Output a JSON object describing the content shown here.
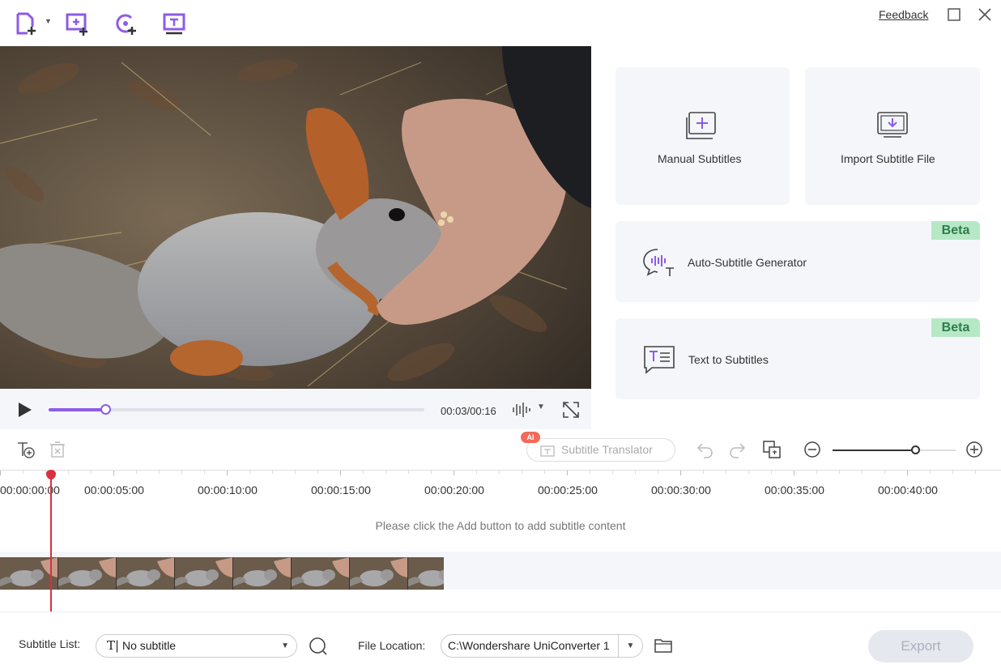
{
  "topbar": {
    "icons": [
      "add-file-icon",
      "add-media-icon",
      "refresh-add-icon",
      "text-subtitle-icon"
    ],
    "feedback_label": "Feedback"
  },
  "player": {
    "time_display": "00:03/00:16",
    "progress": 0.15
  },
  "panel": {
    "manual_subtitles": "Manual Subtitles",
    "import_subtitle": "Import Subtitle File",
    "auto_subtitle": "Auto-Subtitle Generator",
    "text_to_subtitles": "Text to Subtitles",
    "beta_label": "Beta"
  },
  "toolbar": {
    "ai_badge": "AI",
    "translator_label": "Subtitle Translator",
    "zoom_level": 0.67
  },
  "ruler": {
    "ticks": [
      "00:00:00:00",
      "00:00:05:00",
      "00:00:10:00",
      "00:00:15:00",
      "00:00:20:00",
      "00:00:25:00",
      "00:00:30:00",
      "00:00:35:00",
      "00:00:40:00"
    ]
  },
  "timeline": {
    "hint": "Please click the Add button to add subtitle content"
  },
  "bottom": {
    "subtitle_list_label": "Subtitle List:",
    "subtitle_list_value": "No subtitle",
    "file_location_label": "File Location:",
    "file_location_value": "C:\\Wondershare UniConverter 1",
    "export_label": "Export"
  },
  "colors": {
    "accent": "#8c5ce6",
    "playhead": "#d9303e",
    "beta_bg": "#b6e8c6"
  }
}
